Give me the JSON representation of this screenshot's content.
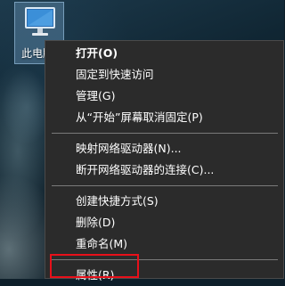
{
  "desktop": {
    "icon": {
      "name": "monitor-icon",
      "label": "此电脑"
    }
  },
  "context_menu": {
    "groups": [
      [
        {
          "label": "打开(O)",
          "bold": true
        },
        {
          "label": "固定到快速访问"
        },
        {
          "label": "管理(G)"
        },
        {
          "label": "从“开始”屏幕取消固定(P)"
        }
      ],
      [
        {
          "label": "映射网络驱动器(N)..."
        },
        {
          "label": "断开网络驱动器的连接(C)..."
        }
      ],
      [
        {
          "label": "创建快捷方式(S)"
        },
        {
          "label": "删除(D)"
        },
        {
          "label": "重命名(M)"
        }
      ],
      [
        {
          "label": "属性(R)"
        }
      ]
    ]
  },
  "colors": {
    "menu_background": "#2b2b2b",
    "menu_text": "#ffffff",
    "highlight_border": "#e8101a"
  }
}
